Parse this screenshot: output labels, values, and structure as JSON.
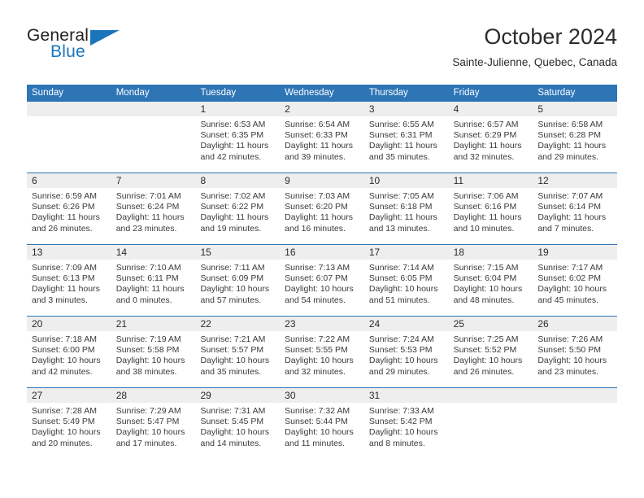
{
  "brand": {
    "name_part1": "General",
    "name_part2": "Blue",
    "logo_icon": "triangle-logo-icon"
  },
  "header": {
    "title": "October 2024",
    "location": "Sainte-Julienne, Quebec, Canada"
  },
  "colors": {
    "header_blue": "#2e75b6",
    "brand_blue": "#1b75bb",
    "day_number_band": "#eeeeee",
    "cell_background": "#ffffff",
    "text": "#3a3a3a"
  },
  "weekdays": [
    "Sunday",
    "Monday",
    "Tuesday",
    "Wednesday",
    "Thursday",
    "Friday",
    "Saturday"
  ],
  "weeks": [
    [
      {
        "day": "",
        "empty": true
      },
      {
        "day": "",
        "empty": true
      },
      {
        "day": "1",
        "sunrise": "Sunrise: 6:53 AM",
        "sunset": "Sunset: 6:35 PM",
        "daylight": "Daylight: 11 hours and 42 minutes."
      },
      {
        "day": "2",
        "sunrise": "Sunrise: 6:54 AM",
        "sunset": "Sunset: 6:33 PM",
        "daylight": "Daylight: 11 hours and 39 minutes."
      },
      {
        "day": "3",
        "sunrise": "Sunrise: 6:55 AM",
        "sunset": "Sunset: 6:31 PM",
        "daylight": "Daylight: 11 hours and 35 minutes."
      },
      {
        "day": "4",
        "sunrise": "Sunrise: 6:57 AM",
        "sunset": "Sunset: 6:29 PM",
        "daylight": "Daylight: 11 hours and 32 minutes."
      },
      {
        "day": "5",
        "sunrise": "Sunrise: 6:58 AM",
        "sunset": "Sunset: 6:28 PM",
        "daylight": "Daylight: 11 hours and 29 minutes."
      }
    ],
    [
      {
        "day": "6",
        "sunrise": "Sunrise: 6:59 AM",
        "sunset": "Sunset: 6:26 PM",
        "daylight": "Daylight: 11 hours and 26 minutes."
      },
      {
        "day": "7",
        "sunrise": "Sunrise: 7:01 AM",
        "sunset": "Sunset: 6:24 PM",
        "daylight": "Daylight: 11 hours and 23 minutes."
      },
      {
        "day": "8",
        "sunrise": "Sunrise: 7:02 AM",
        "sunset": "Sunset: 6:22 PM",
        "daylight": "Daylight: 11 hours and 19 minutes."
      },
      {
        "day": "9",
        "sunrise": "Sunrise: 7:03 AM",
        "sunset": "Sunset: 6:20 PM",
        "daylight": "Daylight: 11 hours and 16 minutes."
      },
      {
        "day": "10",
        "sunrise": "Sunrise: 7:05 AM",
        "sunset": "Sunset: 6:18 PM",
        "daylight": "Daylight: 11 hours and 13 minutes."
      },
      {
        "day": "11",
        "sunrise": "Sunrise: 7:06 AM",
        "sunset": "Sunset: 6:16 PM",
        "daylight": "Daylight: 11 hours and 10 minutes."
      },
      {
        "day": "12",
        "sunrise": "Sunrise: 7:07 AM",
        "sunset": "Sunset: 6:14 PM",
        "daylight": "Daylight: 11 hours and 7 minutes."
      }
    ],
    [
      {
        "day": "13",
        "sunrise": "Sunrise: 7:09 AM",
        "sunset": "Sunset: 6:13 PM",
        "daylight": "Daylight: 11 hours and 3 minutes."
      },
      {
        "day": "14",
        "sunrise": "Sunrise: 7:10 AM",
        "sunset": "Sunset: 6:11 PM",
        "daylight": "Daylight: 11 hours and 0 minutes."
      },
      {
        "day": "15",
        "sunrise": "Sunrise: 7:11 AM",
        "sunset": "Sunset: 6:09 PM",
        "daylight": "Daylight: 10 hours and 57 minutes."
      },
      {
        "day": "16",
        "sunrise": "Sunrise: 7:13 AM",
        "sunset": "Sunset: 6:07 PM",
        "daylight": "Daylight: 10 hours and 54 minutes."
      },
      {
        "day": "17",
        "sunrise": "Sunrise: 7:14 AM",
        "sunset": "Sunset: 6:05 PM",
        "daylight": "Daylight: 10 hours and 51 minutes."
      },
      {
        "day": "18",
        "sunrise": "Sunrise: 7:15 AM",
        "sunset": "Sunset: 6:04 PM",
        "daylight": "Daylight: 10 hours and 48 minutes."
      },
      {
        "day": "19",
        "sunrise": "Sunrise: 7:17 AM",
        "sunset": "Sunset: 6:02 PM",
        "daylight": "Daylight: 10 hours and 45 minutes."
      }
    ],
    [
      {
        "day": "20",
        "sunrise": "Sunrise: 7:18 AM",
        "sunset": "Sunset: 6:00 PM",
        "daylight": "Daylight: 10 hours and 42 minutes."
      },
      {
        "day": "21",
        "sunrise": "Sunrise: 7:19 AM",
        "sunset": "Sunset: 5:58 PM",
        "daylight": "Daylight: 10 hours and 38 minutes."
      },
      {
        "day": "22",
        "sunrise": "Sunrise: 7:21 AM",
        "sunset": "Sunset: 5:57 PM",
        "daylight": "Daylight: 10 hours and 35 minutes."
      },
      {
        "day": "23",
        "sunrise": "Sunrise: 7:22 AM",
        "sunset": "Sunset: 5:55 PM",
        "daylight": "Daylight: 10 hours and 32 minutes."
      },
      {
        "day": "24",
        "sunrise": "Sunrise: 7:24 AM",
        "sunset": "Sunset: 5:53 PM",
        "daylight": "Daylight: 10 hours and 29 minutes."
      },
      {
        "day": "25",
        "sunrise": "Sunrise: 7:25 AM",
        "sunset": "Sunset: 5:52 PM",
        "daylight": "Daylight: 10 hours and 26 minutes."
      },
      {
        "day": "26",
        "sunrise": "Sunrise: 7:26 AM",
        "sunset": "Sunset: 5:50 PM",
        "daylight": "Daylight: 10 hours and 23 minutes."
      }
    ],
    [
      {
        "day": "27",
        "sunrise": "Sunrise: 7:28 AM",
        "sunset": "Sunset: 5:49 PM",
        "daylight": "Daylight: 10 hours and 20 minutes."
      },
      {
        "day": "28",
        "sunrise": "Sunrise: 7:29 AM",
        "sunset": "Sunset: 5:47 PM",
        "daylight": "Daylight: 10 hours and 17 minutes."
      },
      {
        "day": "29",
        "sunrise": "Sunrise: 7:31 AM",
        "sunset": "Sunset: 5:45 PM",
        "daylight": "Daylight: 10 hours and 14 minutes."
      },
      {
        "day": "30",
        "sunrise": "Sunrise: 7:32 AM",
        "sunset": "Sunset: 5:44 PM",
        "daylight": "Daylight: 10 hours and 11 minutes."
      },
      {
        "day": "31",
        "sunrise": "Sunrise: 7:33 AM",
        "sunset": "Sunset: 5:42 PM",
        "daylight": "Daylight: 10 hours and 8 minutes."
      },
      {
        "day": "",
        "empty": true
      },
      {
        "day": "",
        "empty": true
      }
    ]
  ]
}
